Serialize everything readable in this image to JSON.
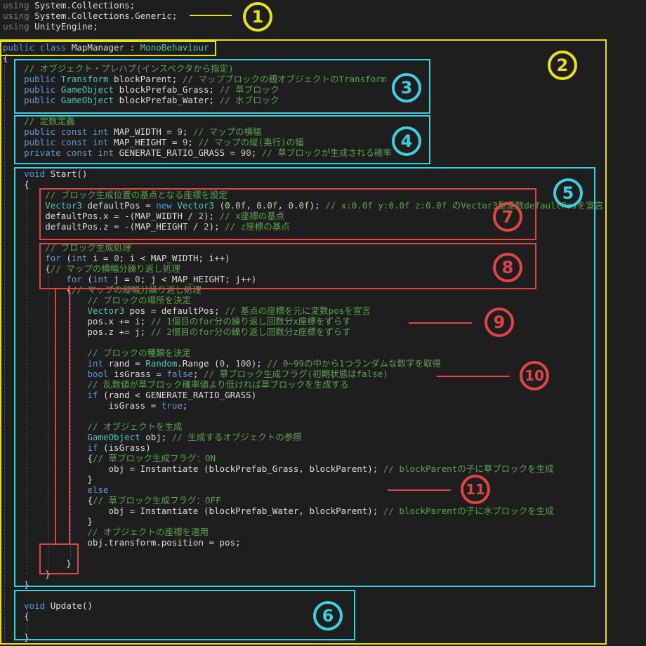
{
  "file": {
    "lines": [
      [
        [
          "kw",
          "using"
        ],
        [
          "p",
          " System.Collections;"
        ]
      ],
      [
        [
          "kw",
          "using"
        ],
        [
          "p",
          " System.Collections.Generic;"
        ]
      ],
      [
        [
          "kw",
          "using"
        ],
        [
          "p",
          " UnityEngine;"
        ]
      ],
      [],
      [
        [
          "kw",
          "public class"
        ],
        [
          "p",
          " MapManager : "
        ],
        [
          "ty",
          "MonoBehaviour"
        ]
      ],
      [
        [
          "p",
          "{"
        ]
      ],
      [
        [
          "cm",
          "    // オブジェクト・プレハブ(インスペクタから指定)"
        ]
      ],
      [
        [
          "kw",
          "    public"
        ],
        [
          "ty",
          " Transform"
        ],
        [
          "p",
          " blockParent; "
        ],
        [
          "cm",
          "// マップブロックの親オブジェクトのTransform"
        ]
      ],
      [
        [
          "kw",
          "    public"
        ],
        [
          "ty",
          " GameObject"
        ],
        [
          "p",
          " blockPrefab_Grass; "
        ],
        [
          "cm",
          "// 草ブロック"
        ]
      ],
      [
        [
          "kw",
          "    public"
        ],
        [
          "ty",
          " GameObject"
        ],
        [
          "p",
          " blockPrefab_Water; "
        ],
        [
          "cm",
          "// 水ブロック"
        ]
      ],
      [],
      [
        [
          "cm",
          "    // 定数定義"
        ]
      ],
      [
        [
          "kw",
          "    public const int"
        ],
        [
          "p",
          " MAP_WIDTH = "
        ],
        [
          "nm",
          "9"
        ],
        [
          "p",
          "; "
        ],
        [
          "cm",
          "// マップの横幅"
        ]
      ],
      [
        [
          "kw",
          "    public const int"
        ],
        [
          "p",
          " MAP_HEIGHT = "
        ],
        [
          "nm",
          "9"
        ],
        [
          "p",
          "; "
        ],
        [
          "cm",
          "// マップの縦(奥行)の幅"
        ]
      ],
      [
        [
          "kw",
          "    private const int"
        ],
        [
          "p",
          " GENERATE_RATIO_GRASS = "
        ],
        [
          "nm",
          "90"
        ],
        [
          "p",
          "; "
        ],
        [
          "cm",
          "// 草ブロックが生成される確率"
        ]
      ],
      [],
      [
        [
          "kw",
          "    void"
        ],
        [
          "p",
          " Start()"
        ]
      ],
      [
        [
          "p",
          "    {"
        ]
      ],
      [
        [
          "cm",
          "        // ブロック生成位置の基点となる座標を設定"
        ]
      ],
      [
        [
          "ty",
          "        Vector3"
        ],
        [
          "p",
          " defaultPos = "
        ],
        [
          "kw",
          "new"
        ],
        [
          "ty",
          " Vector3"
        ],
        [
          "p",
          " ("
        ],
        [
          "nm",
          "0.0f"
        ],
        [
          "p",
          ", "
        ],
        [
          "nm",
          "0.0f"
        ],
        [
          "p",
          ", "
        ],
        [
          "nm",
          "0.0f"
        ],
        [
          "p",
          "); "
        ],
        [
          "cm",
          "// x:0.0f y:0.0f z:0.0f のVector3型変数defaultPosを宣言"
        ]
      ],
      [
        [
          "p",
          "        defaultPos.x = -(MAP_WIDTH / "
        ],
        [
          "nm",
          "2"
        ],
        [
          "p",
          "); "
        ],
        [
          "cm",
          "// x座標の基点"
        ]
      ],
      [
        [
          "p",
          "        defaultPos.z = -(MAP_HEIGHT / "
        ],
        [
          "nm",
          "2"
        ],
        [
          "p",
          "); "
        ],
        [
          "cm",
          "// z座標の基点"
        ]
      ],
      [],
      [
        [
          "cm",
          "        // ブロック生成処理"
        ]
      ],
      [
        [
          "kw",
          "        for"
        ],
        [
          "p",
          " ("
        ],
        [
          "kw",
          "int"
        ],
        [
          "p",
          " i = "
        ],
        [
          "nm",
          "0"
        ],
        [
          "p",
          "; i < MAP_WIDTH; i++)"
        ]
      ],
      [
        [
          "p",
          "        {"
        ],
        [
          "cm",
          "// マップの横幅分繰り返し処理"
        ]
      ],
      [
        [
          "kw",
          "            for"
        ],
        [
          "p",
          " ("
        ],
        [
          "kw",
          "int"
        ],
        [
          "p",
          " j = "
        ],
        [
          "nm",
          "0"
        ],
        [
          "p",
          "; j < MAP_HEIGHT; j++)"
        ]
      ],
      [
        [
          "p",
          "            {"
        ],
        [
          "cm",
          "// マップの縦幅分繰り返し処理"
        ]
      ],
      [
        [
          "cm",
          "                // ブロックの場所を決定"
        ]
      ],
      [
        [
          "ty",
          "                Vector3"
        ],
        [
          "p",
          " pos = defaultPos; "
        ],
        [
          "cm",
          "// 基点の座標を元に変数posを宣言"
        ]
      ],
      [
        [
          "p",
          "                pos.x += i; "
        ],
        [
          "cm",
          "// 1個目のfor分の繰り返し回数分x座標をずらす"
        ]
      ],
      [
        [
          "p",
          "                pos.z += j; "
        ],
        [
          "cm",
          "// 2個目のfor分の繰り返し回数分z座標をずらす"
        ]
      ],
      [],
      [
        [
          "cm",
          "                // ブロックの種類を決定"
        ]
      ],
      [
        [
          "kw",
          "                int"
        ],
        [
          "p",
          " rand = "
        ],
        [
          "ty",
          "Random"
        ],
        [
          "p",
          ".Range ("
        ],
        [
          "nm",
          "0"
        ],
        [
          "p",
          ", "
        ],
        [
          "nm",
          "100"
        ],
        [
          "p",
          "); "
        ],
        [
          "cm",
          "// 0~99の中から1つランダムな数字を取得"
        ]
      ],
      [
        [
          "kw",
          "                bool"
        ],
        [
          "p",
          " isGrass = "
        ],
        [
          "kw",
          "false"
        ],
        [
          "p",
          "; "
        ],
        [
          "cm",
          "// 草ブロック生成フラグ(初期状態はfalse)"
        ]
      ],
      [
        [
          "cm",
          "                // 乱数値が草ブロック確率値より低ければ草ブロックを生成する"
        ]
      ],
      [
        [
          "kw",
          "                if"
        ],
        [
          "p",
          " (rand < GENERATE_RATIO_GRASS)"
        ]
      ],
      [
        [
          "p",
          "                    isGrass = "
        ],
        [
          "kw",
          "true"
        ],
        [
          "p",
          ";"
        ]
      ],
      [],
      [
        [
          "cm",
          "                // オブジェクトを生成"
        ]
      ],
      [
        [
          "ty",
          "                GameObject"
        ],
        [
          "p",
          " obj; "
        ],
        [
          "cm",
          "// 生成するオブジェクトの参照"
        ]
      ],
      [
        [
          "kw",
          "                if"
        ],
        [
          "p",
          " (isGrass)"
        ]
      ],
      [
        [
          "p",
          "                {"
        ],
        [
          "cm",
          "// 草ブロック生成フラグ：ON"
        ]
      ],
      [
        [
          "p",
          "                    obj = Instantiate (blockPrefab_Grass, blockParent); "
        ],
        [
          "cm",
          "// blockParentの子に草ブロックを生成"
        ]
      ],
      [
        [
          "p",
          "                }"
        ]
      ],
      [
        [
          "kw",
          "                else"
        ]
      ],
      [
        [
          "p",
          "                {"
        ],
        [
          "cm",
          "// 草ブロック生成フラグ：OFF"
        ]
      ],
      [
        [
          "p",
          "                    obj = Instantiate (blockPrefab_Water, blockParent); "
        ],
        [
          "cm",
          "// blockParentの子に水ブロックを生成"
        ]
      ],
      [
        [
          "p",
          "                }"
        ]
      ],
      [
        [
          "cm",
          "                // オブジェクトの座標を適用"
        ]
      ],
      [
        [
          "p",
          "                obj.transform.position = pos;"
        ]
      ],
      [],
      [
        [
          "p",
          "            }"
        ]
      ],
      [
        [
          "p",
          "        }"
        ]
      ],
      [
        [
          "p",
          "    }"
        ]
      ],
      [],
      [
        [
          "kw",
          "    void"
        ],
        [
          "p",
          " Update()"
        ]
      ],
      [
        [
          "p",
          "    {"
        ]
      ],
      [],
      [
        [
          "p",
          "    }"
        ]
      ]
    ]
  },
  "colors": {
    "yellow": "#e8e01e",
    "cyan": "#3ccfe0",
    "red": "#e04545"
  },
  "badges": {
    "b1": "1",
    "b2": "2",
    "b3": "3",
    "b4": "4",
    "b5": "5",
    "b6": "6",
    "b7": "7",
    "b8": "8",
    "b9": "9",
    "b10": "10",
    "b11": "11"
  }
}
